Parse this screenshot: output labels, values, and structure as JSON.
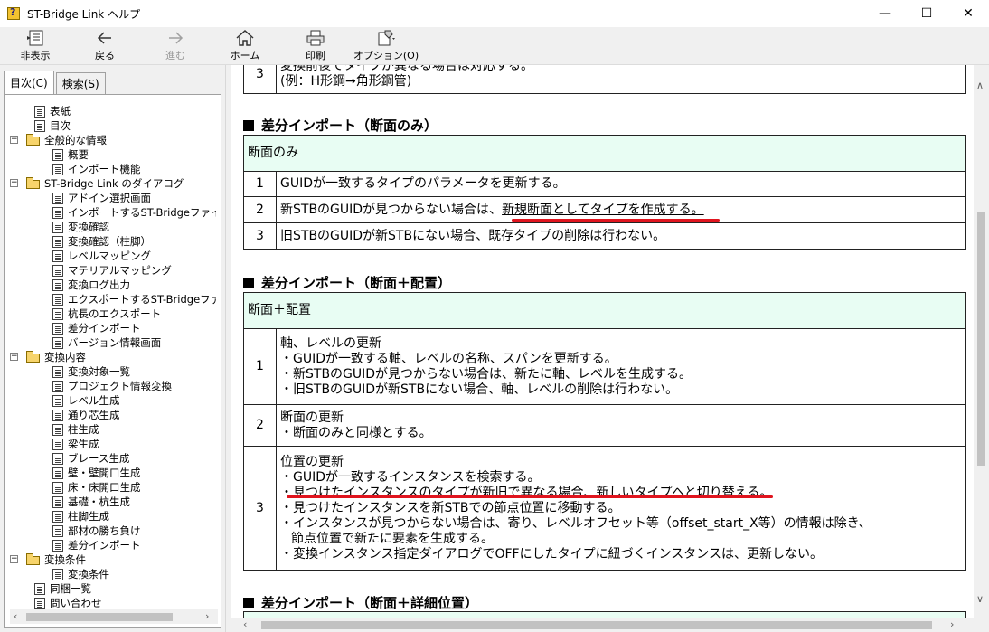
{
  "window": {
    "title": "ST-Bridge Link ヘルプ",
    "min_glyph": "—",
    "max_glyph": "☐",
    "close_glyph": "✕"
  },
  "toolbar": {
    "hide": "非表示",
    "back": "戻る",
    "forward": "進む",
    "home": "ホーム",
    "print": "印刷",
    "options": "オプション(O)"
  },
  "tabs": {
    "contents": "目次(C)",
    "search": "検索(S)"
  },
  "tree": [
    {
      "label": "表紙",
      "level": 1,
      "type": "page"
    },
    {
      "label": "目次",
      "level": 1,
      "type": "page"
    },
    {
      "label": "全般的な情報",
      "level": 0,
      "type": "folder"
    },
    {
      "label": "概要",
      "level": 2,
      "type": "page"
    },
    {
      "label": "インポート機能",
      "level": 2,
      "type": "page"
    },
    {
      "label": "ST-Bridge Link のダイアログ",
      "level": 0,
      "type": "folder"
    },
    {
      "label": "アドイン選択画面",
      "level": 2,
      "type": "page"
    },
    {
      "label": "インポートするST-Bridgeファイル",
      "level": 2,
      "type": "page"
    },
    {
      "label": "変換確認",
      "level": 2,
      "type": "page"
    },
    {
      "label": "変換確認（柱脚）",
      "level": 2,
      "type": "page"
    },
    {
      "label": "レベルマッピング",
      "level": 2,
      "type": "page"
    },
    {
      "label": "マテリアルマッピング",
      "level": 2,
      "type": "page"
    },
    {
      "label": "変換ログ出力",
      "level": 2,
      "type": "page"
    },
    {
      "label": "エクスポートするST-Bridgeファイ",
      "level": 2,
      "type": "page"
    },
    {
      "label": "杭長のエクスポート",
      "level": 2,
      "type": "page"
    },
    {
      "label": "差分インポート",
      "level": 2,
      "type": "page"
    },
    {
      "label": "バージョン情報画面",
      "level": 2,
      "type": "page"
    },
    {
      "label": "変換内容",
      "level": 0,
      "type": "folder"
    },
    {
      "label": "変換対象一覧",
      "level": 2,
      "type": "page"
    },
    {
      "label": "プロジェクト情報変換",
      "level": 2,
      "type": "page"
    },
    {
      "label": "レベル生成",
      "level": 2,
      "type": "page"
    },
    {
      "label": "通り芯生成",
      "level": 2,
      "type": "page"
    },
    {
      "label": "柱生成",
      "level": 2,
      "type": "page"
    },
    {
      "label": "梁生成",
      "level": 2,
      "type": "page"
    },
    {
      "label": "ブレース生成",
      "level": 2,
      "type": "page"
    },
    {
      "label": "壁・壁開口生成",
      "level": 2,
      "type": "page"
    },
    {
      "label": "床・床開口生成",
      "level": 2,
      "type": "page"
    },
    {
      "label": "基礎・杭生成",
      "level": 2,
      "type": "page"
    },
    {
      "label": "柱脚生成",
      "level": 2,
      "type": "page"
    },
    {
      "label": "部材の勝ち負け",
      "level": 2,
      "type": "page"
    },
    {
      "label": "差分インポート",
      "level": 2,
      "type": "page"
    },
    {
      "label": "変換条件",
      "level": 0,
      "type": "folder"
    },
    {
      "label": "変換条件",
      "level": 2,
      "type": "page"
    },
    {
      "label": "同梱一覧",
      "level": 1,
      "type": "page"
    },
    {
      "label": "問い合わせ",
      "level": 1,
      "type": "page"
    }
  ],
  "content": {
    "prev_table": {
      "num": "3",
      "line1": "変換前後でタイプが異なる場合は対応する。",
      "line2": "(例：H形鋼→角形鋼管)"
    },
    "section1": {
      "heading": "差分インポート（断面のみ）",
      "header": "断面のみ",
      "rows": [
        {
          "num": "1",
          "text": "GUIDが一致するタイプのパラメータを更新する。"
        },
        {
          "num": "2",
          "text_a": "新STBのGUIDが見つからない場合は、",
          "text_b": "新規断面としてタイプを作成する。"
        },
        {
          "num": "3",
          "text": "旧STBのGUIDが新STBにない場合、既存タイプの削除は行わない。"
        }
      ]
    },
    "section2": {
      "heading": "差分インポート（断面＋配置）",
      "header": "断面＋配置",
      "rows": [
        {
          "num": "1",
          "lines": [
            "軸、レベルの更新",
            "・GUIDが一致する軸、レベルの名称、スパンを更新する。",
            "・新STBのGUIDが見つからない場合は、新たに軸、レベルを生成する。",
            "・旧STBのGUIDが新STBにない場合、軸、レベルの削除は行わない。"
          ]
        },
        {
          "num": "2",
          "lines": [
            "断面の更新",
            "・断面のみと同様とする。"
          ]
        },
        {
          "num": "3",
          "lines": [
            "位置の更新",
            "・GUIDが一致するインスタンスを検索する。",
            "・見つけたインスタンスのタイプが新旧で異なる場合、新しいタイプへと切り替える。",
            "・見つけたインスタンスを新STBでの節点位置に移動する。",
            "・インスタンスが見つからない場合は、寄り、レベルオフセット等（offset_start_X等）の情報は除き、",
            "節点位置で新たに要素を生成する。",
            "・変換インスタンス指定ダイアログでOFFにしたタイプに紐づくインスタンスは、更新しない。"
          ]
        }
      ]
    },
    "section3": {
      "heading": "差分インポート（断面＋詳細位置）"
    }
  }
}
